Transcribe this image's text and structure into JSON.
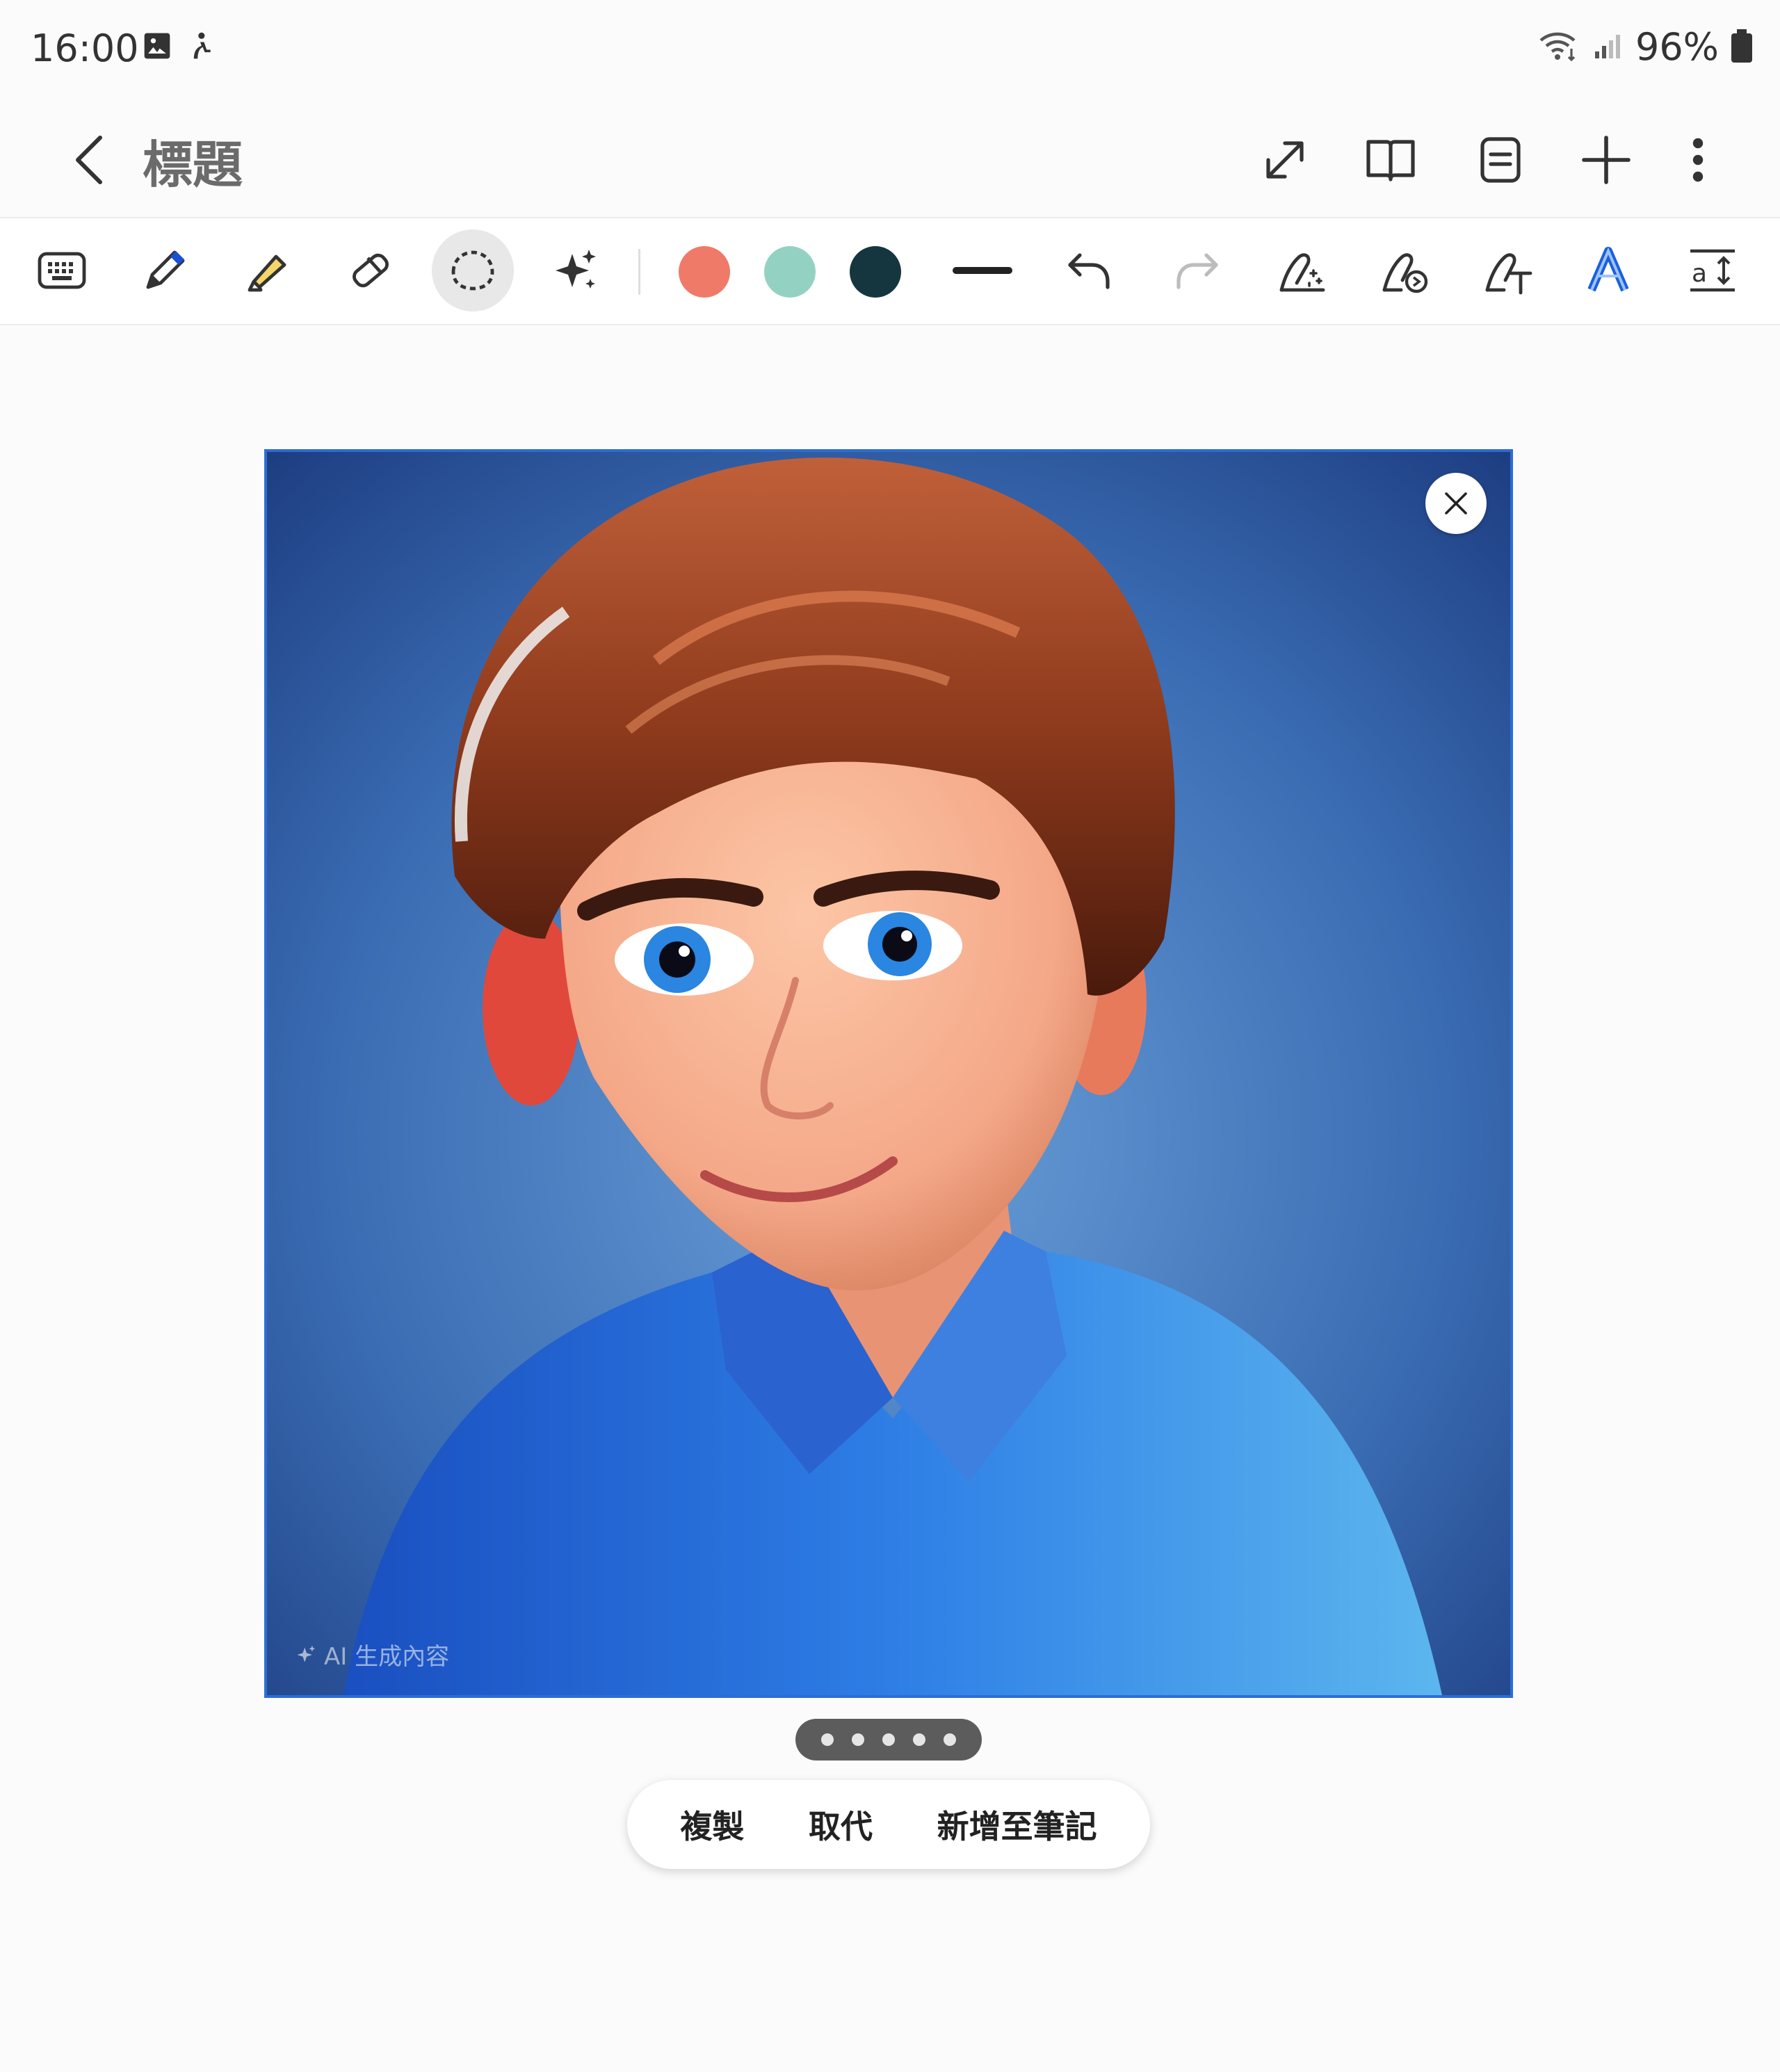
{
  "status_bar": {
    "time": "16:00",
    "icons": [
      "image-notification-icon",
      "accessibility-icon"
    ],
    "right_icons": [
      "wifi-icon",
      "signal-icon",
      "battery-icon"
    ],
    "battery_percent": "96%"
  },
  "header": {
    "title": "標題",
    "buttons": [
      "expand-icon",
      "book-view-icon",
      "text-view-icon",
      "add-icon",
      "more-options-icon"
    ]
  },
  "toolbar": {
    "tools": [
      "keyboard-icon",
      "pen-icon",
      "highlighter-icon",
      "eraser-icon",
      "lasso-select-icon",
      "ai-sparkle-icon"
    ],
    "selected_tool": "lasso-select-icon",
    "colors": [
      "#ef7a68",
      "#93d2c2",
      "#15363f"
    ],
    "stroke": "stroke-width-icon",
    "history": [
      "undo-icon",
      "redo-icon"
    ],
    "extra_tools": [
      "drawing-assist-icon",
      "shape-assist-icon",
      "handwriting-to-text-icon",
      "text-style-icon",
      "text-size-icon"
    ]
  },
  "image_panel": {
    "watermark": "AI 生成內容",
    "close_icon": "close-icon",
    "accent_color": "#2c6dd6"
  },
  "pager": {
    "count": 5
  },
  "action_menu": {
    "copy_label": "複製",
    "replace_label": "取代",
    "add_to_note_label": "新增至筆記"
  }
}
